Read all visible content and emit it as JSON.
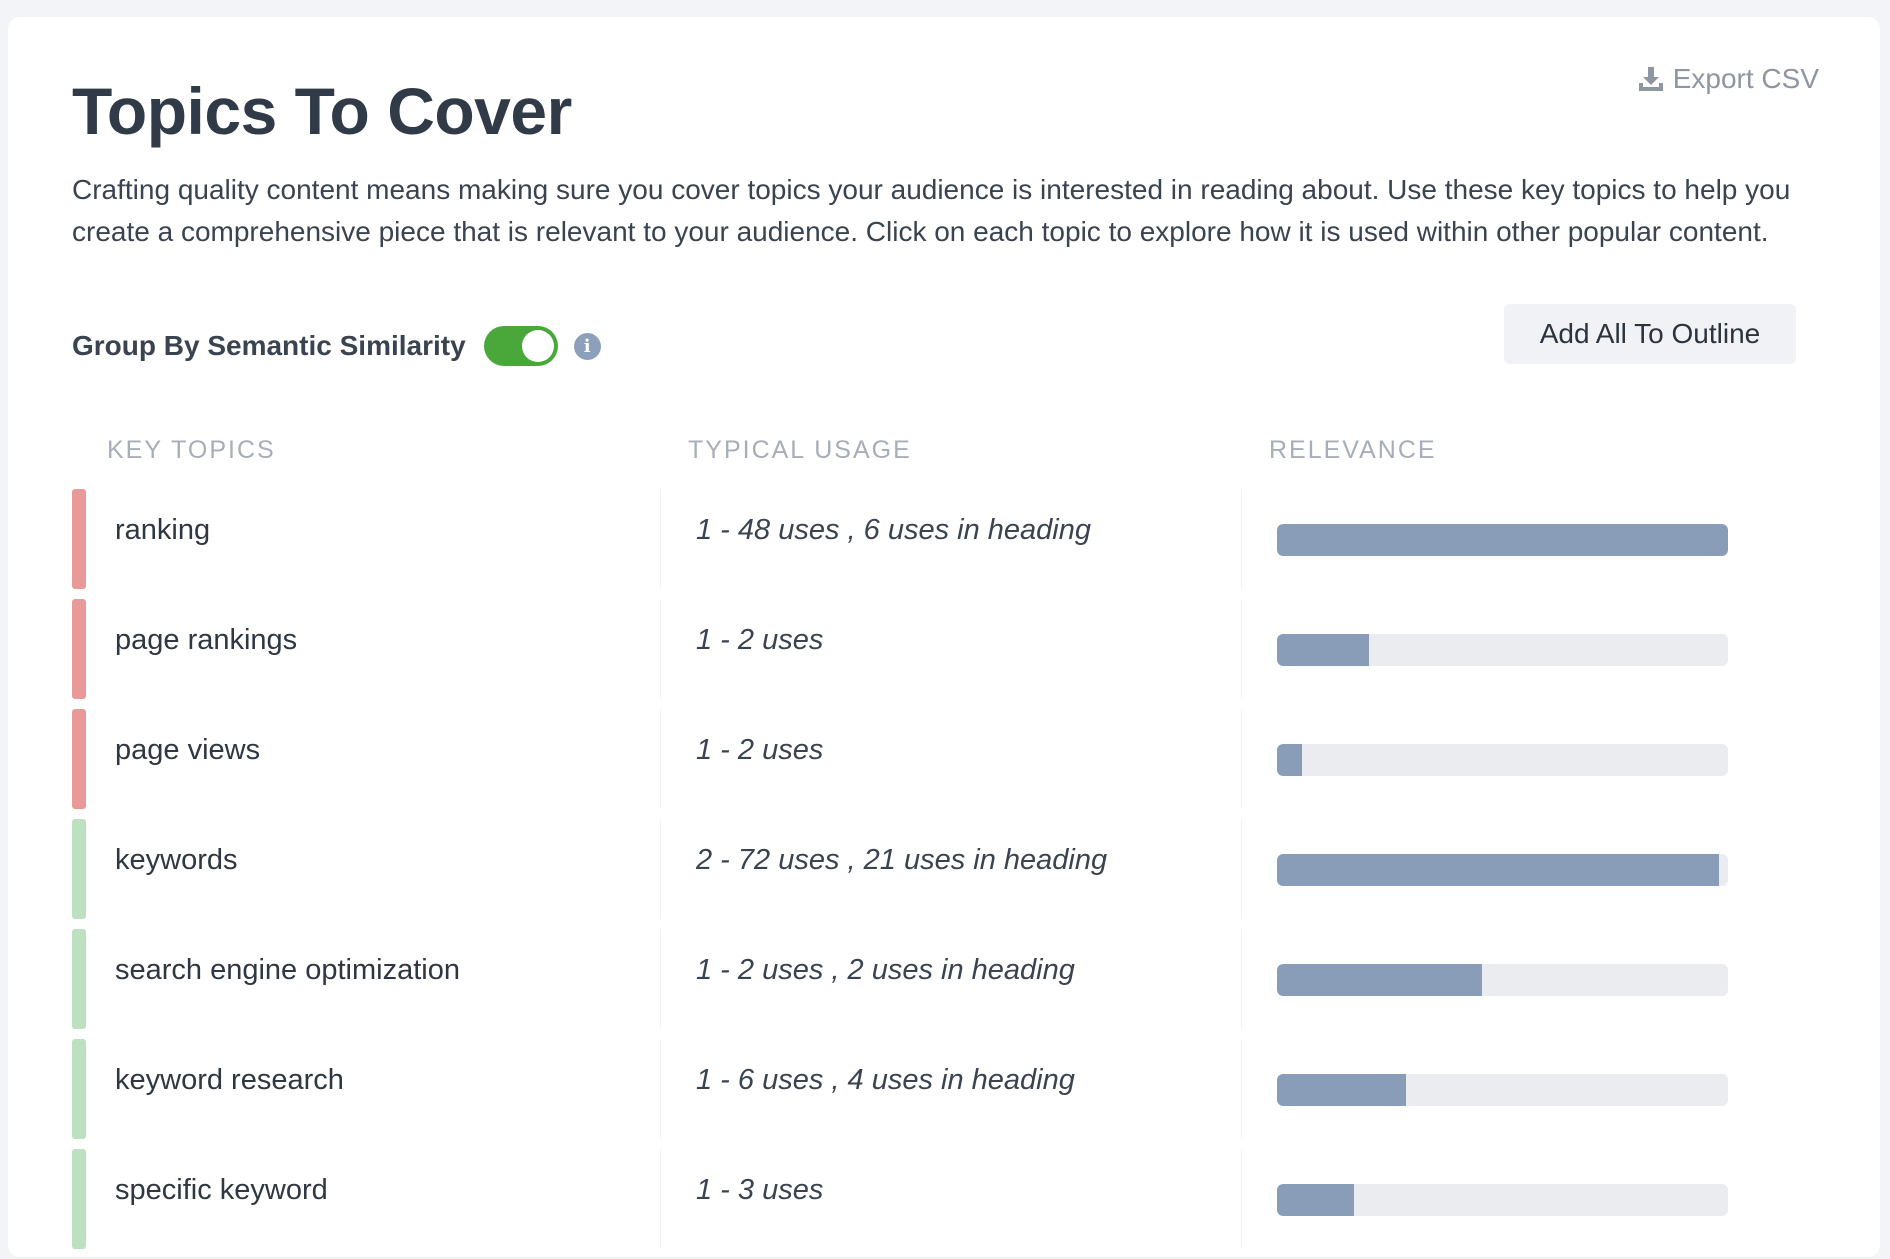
{
  "header": {
    "title": "Topics To Cover",
    "export_label": "Export CSV",
    "description": "Crafting quality content means making sure you cover topics your audience is interested in reading about. Use these key topics to help you create a comprehensive piece that is relevant to your audience. Click on each topic to explore how it is used within other popular content."
  },
  "controls": {
    "group_label": "Group By Semantic Similarity",
    "group_enabled": true,
    "add_all_label": "Add All To Outline"
  },
  "table": {
    "columns": [
      "KEY TOPICS",
      "TYPICAL USAGE",
      "RELEVANCE"
    ],
    "rows": [
      {
        "topic": "ranking",
        "usage": "1 - 48 uses , 6 uses in heading",
        "relevance": 1.0,
        "group_color": "#e89a9a"
      },
      {
        "topic": "page rankings",
        "usage": "1 - 2 uses",
        "relevance": 0.205,
        "group_color": "#e89a9a"
      },
      {
        "topic": "page views",
        "usage": "1 - 2 uses",
        "relevance": 0.055,
        "group_color": "#e89a9a"
      },
      {
        "topic": "keywords",
        "usage": "2 - 72 uses , 21 uses in heading",
        "relevance": 0.98,
        "group_color": "#bde0c0"
      },
      {
        "topic": "search engine optimization",
        "usage": "1 - 2 uses , 2 uses in heading",
        "relevance": 0.455,
        "group_color": "#bde0c0"
      },
      {
        "topic": "keyword research",
        "usage": "1 - 6 uses , 4 uses in heading",
        "relevance": 0.285,
        "group_color": "#bde0c0"
      },
      {
        "topic": "specific keyword",
        "usage": "1 - 3 uses",
        "relevance": 0.17,
        "group_color": "#bde0c0"
      }
    ]
  },
  "colors": {
    "toggle_on": "#4aa83b",
    "bar_fill": "#8a9db8",
    "bar_track": "#ebecf0"
  },
  "icons": {
    "export": "download-icon",
    "info": "info-icon"
  }
}
